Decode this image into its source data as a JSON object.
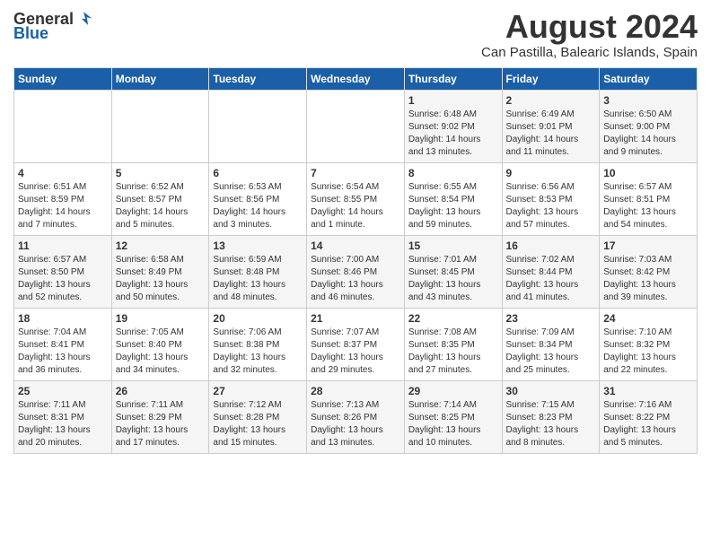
{
  "header": {
    "logo_general": "General",
    "logo_blue": "Blue",
    "title": "August 2024",
    "subtitle": "Can Pastilla, Balearic Islands, Spain"
  },
  "weekdays": [
    "Sunday",
    "Monday",
    "Tuesday",
    "Wednesday",
    "Thursday",
    "Friday",
    "Saturday"
  ],
  "weeks": [
    [
      {
        "day": "",
        "content": ""
      },
      {
        "day": "",
        "content": ""
      },
      {
        "day": "",
        "content": ""
      },
      {
        "day": "",
        "content": ""
      },
      {
        "day": "1",
        "content": "Sunrise: 6:48 AM\nSunset: 9:02 PM\nDaylight: 14 hours\nand 13 minutes."
      },
      {
        "day": "2",
        "content": "Sunrise: 6:49 AM\nSunset: 9:01 PM\nDaylight: 14 hours\nand 11 minutes."
      },
      {
        "day": "3",
        "content": "Sunrise: 6:50 AM\nSunset: 9:00 PM\nDaylight: 14 hours\nand 9 minutes."
      }
    ],
    [
      {
        "day": "4",
        "content": "Sunrise: 6:51 AM\nSunset: 8:59 PM\nDaylight: 14 hours\nand 7 minutes."
      },
      {
        "day": "5",
        "content": "Sunrise: 6:52 AM\nSunset: 8:57 PM\nDaylight: 14 hours\nand 5 minutes."
      },
      {
        "day": "6",
        "content": "Sunrise: 6:53 AM\nSunset: 8:56 PM\nDaylight: 14 hours\nand 3 minutes."
      },
      {
        "day": "7",
        "content": "Sunrise: 6:54 AM\nSunset: 8:55 PM\nDaylight: 14 hours\nand 1 minute."
      },
      {
        "day": "8",
        "content": "Sunrise: 6:55 AM\nSunset: 8:54 PM\nDaylight: 13 hours\nand 59 minutes."
      },
      {
        "day": "9",
        "content": "Sunrise: 6:56 AM\nSunset: 8:53 PM\nDaylight: 13 hours\nand 57 minutes."
      },
      {
        "day": "10",
        "content": "Sunrise: 6:57 AM\nSunset: 8:51 PM\nDaylight: 13 hours\nand 54 minutes."
      }
    ],
    [
      {
        "day": "11",
        "content": "Sunrise: 6:57 AM\nSunset: 8:50 PM\nDaylight: 13 hours\nand 52 minutes."
      },
      {
        "day": "12",
        "content": "Sunrise: 6:58 AM\nSunset: 8:49 PM\nDaylight: 13 hours\nand 50 minutes."
      },
      {
        "day": "13",
        "content": "Sunrise: 6:59 AM\nSunset: 8:48 PM\nDaylight: 13 hours\nand 48 minutes."
      },
      {
        "day": "14",
        "content": "Sunrise: 7:00 AM\nSunset: 8:46 PM\nDaylight: 13 hours\nand 46 minutes."
      },
      {
        "day": "15",
        "content": "Sunrise: 7:01 AM\nSunset: 8:45 PM\nDaylight: 13 hours\nand 43 minutes."
      },
      {
        "day": "16",
        "content": "Sunrise: 7:02 AM\nSunset: 8:44 PM\nDaylight: 13 hours\nand 41 minutes."
      },
      {
        "day": "17",
        "content": "Sunrise: 7:03 AM\nSunset: 8:42 PM\nDaylight: 13 hours\nand 39 minutes."
      }
    ],
    [
      {
        "day": "18",
        "content": "Sunrise: 7:04 AM\nSunset: 8:41 PM\nDaylight: 13 hours\nand 36 minutes."
      },
      {
        "day": "19",
        "content": "Sunrise: 7:05 AM\nSunset: 8:40 PM\nDaylight: 13 hours\nand 34 minutes."
      },
      {
        "day": "20",
        "content": "Sunrise: 7:06 AM\nSunset: 8:38 PM\nDaylight: 13 hours\nand 32 minutes."
      },
      {
        "day": "21",
        "content": "Sunrise: 7:07 AM\nSunset: 8:37 PM\nDaylight: 13 hours\nand 29 minutes."
      },
      {
        "day": "22",
        "content": "Sunrise: 7:08 AM\nSunset: 8:35 PM\nDaylight: 13 hours\nand 27 minutes."
      },
      {
        "day": "23",
        "content": "Sunrise: 7:09 AM\nSunset: 8:34 PM\nDaylight: 13 hours\nand 25 minutes."
      },
      {
        "day": "24",
        "content": "Sunrise: 7:10 AM\nSunset: 8:32 PM\nDaylight: 13 hours\nand 22 minutes."
      }
    ],
    [
      {
        "day": "25",
        "content": "Sunrise: 7:11 AM\nSunset: 8:31 PM\nDaylight: 13 hours\nand 20 minutes."
      },
      {
        "day": "26",
        "content": "Sunrise: 7:11 AM\nSunset: 8:29 PM\nDaylight: 13 hours\nand 17 minutes."
      },
      {
        "day": "27",
        "content": "Sunrise: 7:12 AM\nSunset: 8:28 PM\nDaylight: 13 hours\nand 15 minutes."
      },
      {
        "day": "28",
        "content": "Sunrise: 7:13 AM\nSunset: 8:26 PM\nDaylight: 13 hours\nand 13 minutes."
      },
      {
        "day": "29",
        "content": "Sunrise: 7:14 AM\nSunset: 8:25 PM\nDaylight: 13 hours\nand 10 minutes."
      },
      {
        "day": "30",
        "content": "Sunrise: 7:15 AM\nSunset: 8:23 PM\nDaylight: 13 hours\nand 8 minutes."
      },
      {
        "day": "31",
        "content": "Sunrise: 7:16 AM\nSunset: 8:22 PM\nDaylight: 13 hours\nand 5 minutes."
      }
    ]
  ]
}
